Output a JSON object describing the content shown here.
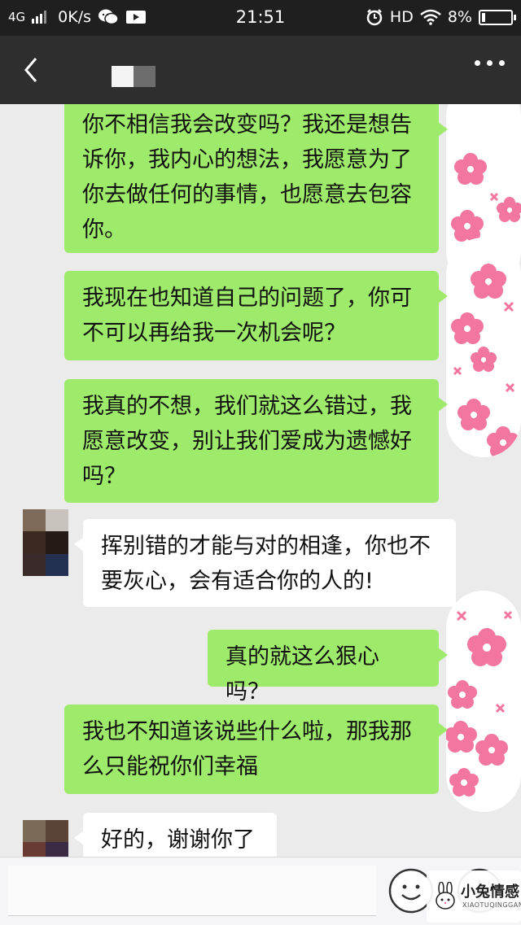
{
  "status_bar": {
    "network": "4G",
    "speed": "0K/s",
    "time": "21:51",
    "hd": "HD",
    "battery": "8%",
    "icons": [
      "signal-icon",
      "wechat-icon",
      "video-icon",
      "alarm-icon",
      "wifi-icon",
      "battery-icon"
    ]
  },
  "header": {
    "back_icon": "chevron-left-icon",
    "more_icon": "more-dots-icon"
  },
  "messages": [
    {
      "side": "out",
      "text": "你不相信我会改变吗？我还是想告\n诉你，我内心的想法，我愿意为了\n你去做任何的事情，也愿意去包容\n你。"
    },
    {
      "side": "out",
      "text": "我现在也知道自己的问题了，你可\n不可以再给我一次机会呢？"
    },
    {
      "side": "out",
      "text": "我真的不想，我们就这么错过，我\n愿意改变，别让我们爱成为遗憾好\n吗？"
    },
    {
      "side": "in",
      "text": "挥别错的才能与对的相逢，你也不\n要灰心，会有适合你的人的!"
    },
    {
      "side": "out",
      "text": "真的就这么狠心吗？"
    },
    {
      "side": "out",
      "text": "我也不知道该说些什么啦，那我那\n么只能祝你们幸福"
    },
    {
      "side": "in",
      "text": "好的，谢谢你了"
    }
  ],
  "colors": {
    "outgoing_bubble": "#9eea6a",
    "incoming_bubble": "#ffffff",
    "chat_background": "#ebebeb",
    "header": "#2e2e2e",
    "flower_pink": "#f2769f"
  },
  "bottom_bar": {
    "emoji_icon": "smiley-icon",
    "plus_icon": "plus-circle-icon"
  },
  "watermark": {
    "title": "小兔情感",
    "subtitle": "XIAOTUQINGGAN"
  }
}
